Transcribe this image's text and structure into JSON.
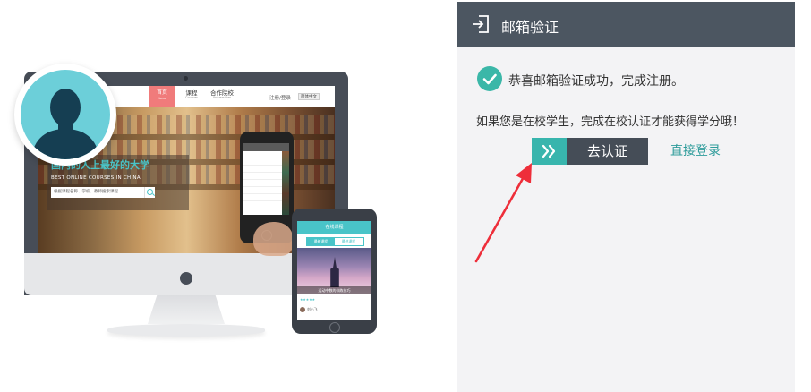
{
  "illustration": {
    "site_nav": {
      "home_label": "首页",
      "home_sub": "Home",
      "courses_label": "课程",
      "courses_sub": "Courses",
      "universities_label": "合作院校",
      "universities_sub": "Universities",
      "login_text": "注册/登录",
      "lang_text": "简体中文"
    },
    "hero": {
      "title": "国内的人上最好的大学",
      "subtitle": "BEST ONLINE COURSES IN CHINA",
      "search_placeholder": "根据课程名称、学校、教师搜索课程"
    },
    "tablet": {
      "header": "在线课程",
      "tab_active": "最新课程",
      "tab_inactive": "最热课程",
      "caption": "运动中数的训练技巧",
      "user": "刘小飞"
    }
  },
  "panel": {
    "title": "邮箱验证",
    "success_message": "恭喜邮箱验证成功，完成注册。",
    "student_prompt": "如果您是在校学生，完成在校认证才能获得学分哦！",
    "verify_button_label": "去认证",
    "direct_login_label": "直接登录"
  },
  "colors": {
    "header_bg": "#4c5661",
    "accent_teal": "#38b5ad",
    "link_teal": "#2f9c9b",
    "arrow_red": "#ee2e3a"
  },
  "icons": {
    "header": "sign-in-icon",
    "success": "check-circle-icon",
    "button": "double-chevron-right-icon",
    "annotation": "red-arrow"
  }
}
